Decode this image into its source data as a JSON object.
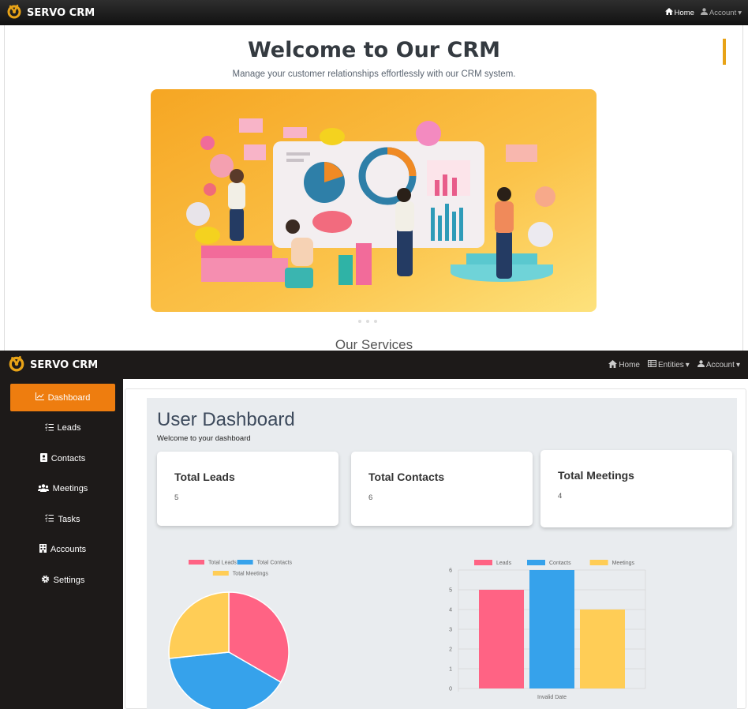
{
  "top": {
    "brand": "SERVO CRM",
    "nav": {
      "home": "Home",
      "account": "Account"
    },
    "hero": {
      "title": "Welcome to Our CRM",
      "subtitle": "Manage your customer relationships effortlessly with our CRM system."
    },
    "services_heading": "Our Services"
  },
  "bottom": {
    "brand": "SERVO CRM",
    "nav": {
      "home": "Home",
      "entities": "Entities",
      "account": "Account"
    },
    "sidebar": [
      {
        "label": "Dashboard",
        "icon": "line-chart-icon",
        "active": true
      },
      {
        "label": "Leads",
        "icon": "list-check-icon",
        "active": false
      },
      {
        "label": "Contacts",
        "icon": "contact-book-icon",
        "active": false
      },
      {
        "label": "Meetings",
        "icon": "people-icon",
        "active": false
      },
      {
        "label": "Tasks",
        "icon": "list-check-icon",
        "active": false
      },
      {
        "label": "Accounts",
        "icon": "building-icon",
        "active": false
      },
      {
        "label": "Settings",
        "icon": "gear-icon",
        "active": false
      }
    ],
    "dashboard": {
      "title": "User Dashboard",
      "subtitle": "Welcome to your dashboard",
      "cards": [
        {
          "title": "Total Leads",
          "value": "5"
        },
        {
          "title": "Total Contacts",
          "value": "6"
        },
        {
          "title": "Total Meetings",
          "value": "4"
        }
      ]
    }
  },
  "colors": {
    "accent": "#ee7d0f",
    "leads": "#ff6384",
    "contacts": "#36a2eb",
    "meetings": "#ffcd56"
  },
  "chart_data": [
    {
      "type": "pie",
      "labels": [
        "Total Leads",
        "Total Contacts",
        "Total Meetings"
      ],
      "values": [
        5,
        6,
        4
      ],
      "colors": [
        "#ff6384",
        "#36a2eb",
        "#ffcd56"
      ],
      "legend": "top"
    },
    {
      "type": "bar",
      "categories": [
        "Invalid Date"
      ],
      "series": [
        {
          "name": "Leads",
          "values": [
            5
          ],
          "color": "#ff6384"
        },
        {
          "name": "Contacts",
          "values": [
            6
          ],
          "color": "#36a2eb"
        },
        {
          "name": "Meetings",
          "values": [
            4
          ],
          "color": "#ffcd56"
        }
      ],
      "ylim": [
        0,
        6
      ],
      "yticks": [
        0,
        1,
        2,
        3,
        4,
        5,
        6
      ],
      "grid": true,
      "legend": "top"
    }
  ]
}
